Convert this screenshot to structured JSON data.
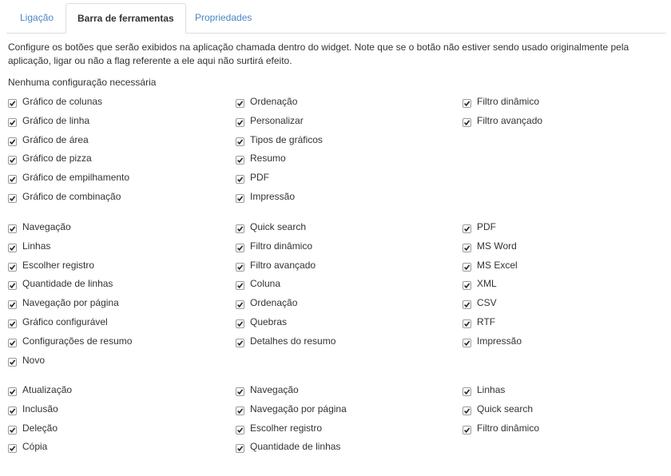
{
  "tabs": [
    {
      "label": "Ligação",
      "active": false
    },
    {
      "label": "Barra de ferramentas",
      "active": true
    },
    {
      "label": "Propriedades",
      "active": false
    }
  ],
  "description": "Configure os botões que serão exibidos na aplicação chamada dentro do widget. Note que se o botão não estiver sendo usado originalmente pela aplicação, ligar ou não a flag referente a ele aqui não surtirá efeito.",
  "no_config_label": "Nenhuma configuração necessária",
  "groups": [
    {
      "columns": [
        [
          {
            "label": "Gráfico de colunas",
            "checked": true
          },
          {
            "label": "Gráfico de linha",
            "checked": true
          },
          {
            "label": "Gráfico de área",
            "checked": true
          },
          {
            "label": "Gráfico de pizza",
            "checked": true
          },
          {
            "label": "Gráfico de empilhamento",
            "checked": true
          },
          {
            "label": "Gráfico de combinação",
            "checked": true
          }
        ],
        [
          {
            "label": "Ordenação",
            "checked": true
          },
          {
            "label": "Personalizar",
            "checked": true
          },
          {
            "label": "Tipos de gráficos",
            "checked": true
          },
          {
            "label": "Resumo",
            "checked": true
          },
          {
            "label": "PDF",
            "checked": true
          },
          {
            "label": "Impressão",
            "checked": true
          }
        ],
        [
          {
            "label": "Filtro dinâmico",
            "checked": true
          },
          {
            "label": "Filtro avançado",
            "checked": true
          }
        ]
      ]
    },
    {
      "columns": [
        [
          {
            "label": "Navegação",
            "checked": true
          },
          {
            "label": "Linhas",
            "checked": true
          },
          {
            "label": "Escolher registro",
            "checked": true
          },
          {
            "label": "Quantidade de linhas",
            "checked": true
          },
          {
            "label": "Navegação por página",
            "checked": true
          },
          {
            "label": "Gráfico configurável",
            "checked": true
          },
          {
            "label": "Configurações de resumo",
            "checked": true
          },
          {
            "label": "Novo",
            "checked": true
          }
        ],
        [
          {
            "label": "Quick search",
            "checked": true
          },
          {
            "label": "Filtro dinâmico",
            "checked": true
          },
          {
            "label": "Filtro avançado",
            "checked": true
          },
          {
            "label": "Coluna",
            "checked": true
          },
          {
            "label": "Ordenação",
            "checked": true
          },
          {
            "label": "Quebras",
            "checked": true
          },
          {
            "label": "Detalhes do resumo",
            "checked": true
          }
        ],
        [
          {
            "label": "PDF",
            "checked": true
          },
          {
            "label": "MS Word",
            "checked": true
          },
          {
            "label": "MS Excel",
            "checked": true
          },
          {
            "label": "XML",
            "checked": true
          },
          {
            "label": "CSV",
            "checked": true
          },
          {
            "label": "RTF",
            "checked": true
          },
          {
            "label": "Impressão",
            "checked": true
          }
        ]
      ]
    },
    {
      "columns": [
        [
          {
            "label": "Atualização",
            "checked": true
          },
          {
            "label": "Inclusão",
            "checked": true
          },
          {
            "label": "Deleção",
            "checked": true
          },
          {
            "label": "Cópia",
            "checked": true
          }
        ],
        [
          {
            "label": "Navegação",
            "checked": true
          },
          {
            "label": "Navegação por página",
            "checked": true
          },
          {
            "label": "Escolher registro",
            "checked": true
          },
          {
            "label": "Quantidade de linhas",
            "checked": true
          }
        ],
        [
          {
            "label": "Linhas",
            "checked": true
          },
          {
            "label": "Quick search",
            "checked": true
          },
          {
            "label": "Filtro dinâmico",
            "checked": true
          }
        ]
      ]
    }
  ]
}
